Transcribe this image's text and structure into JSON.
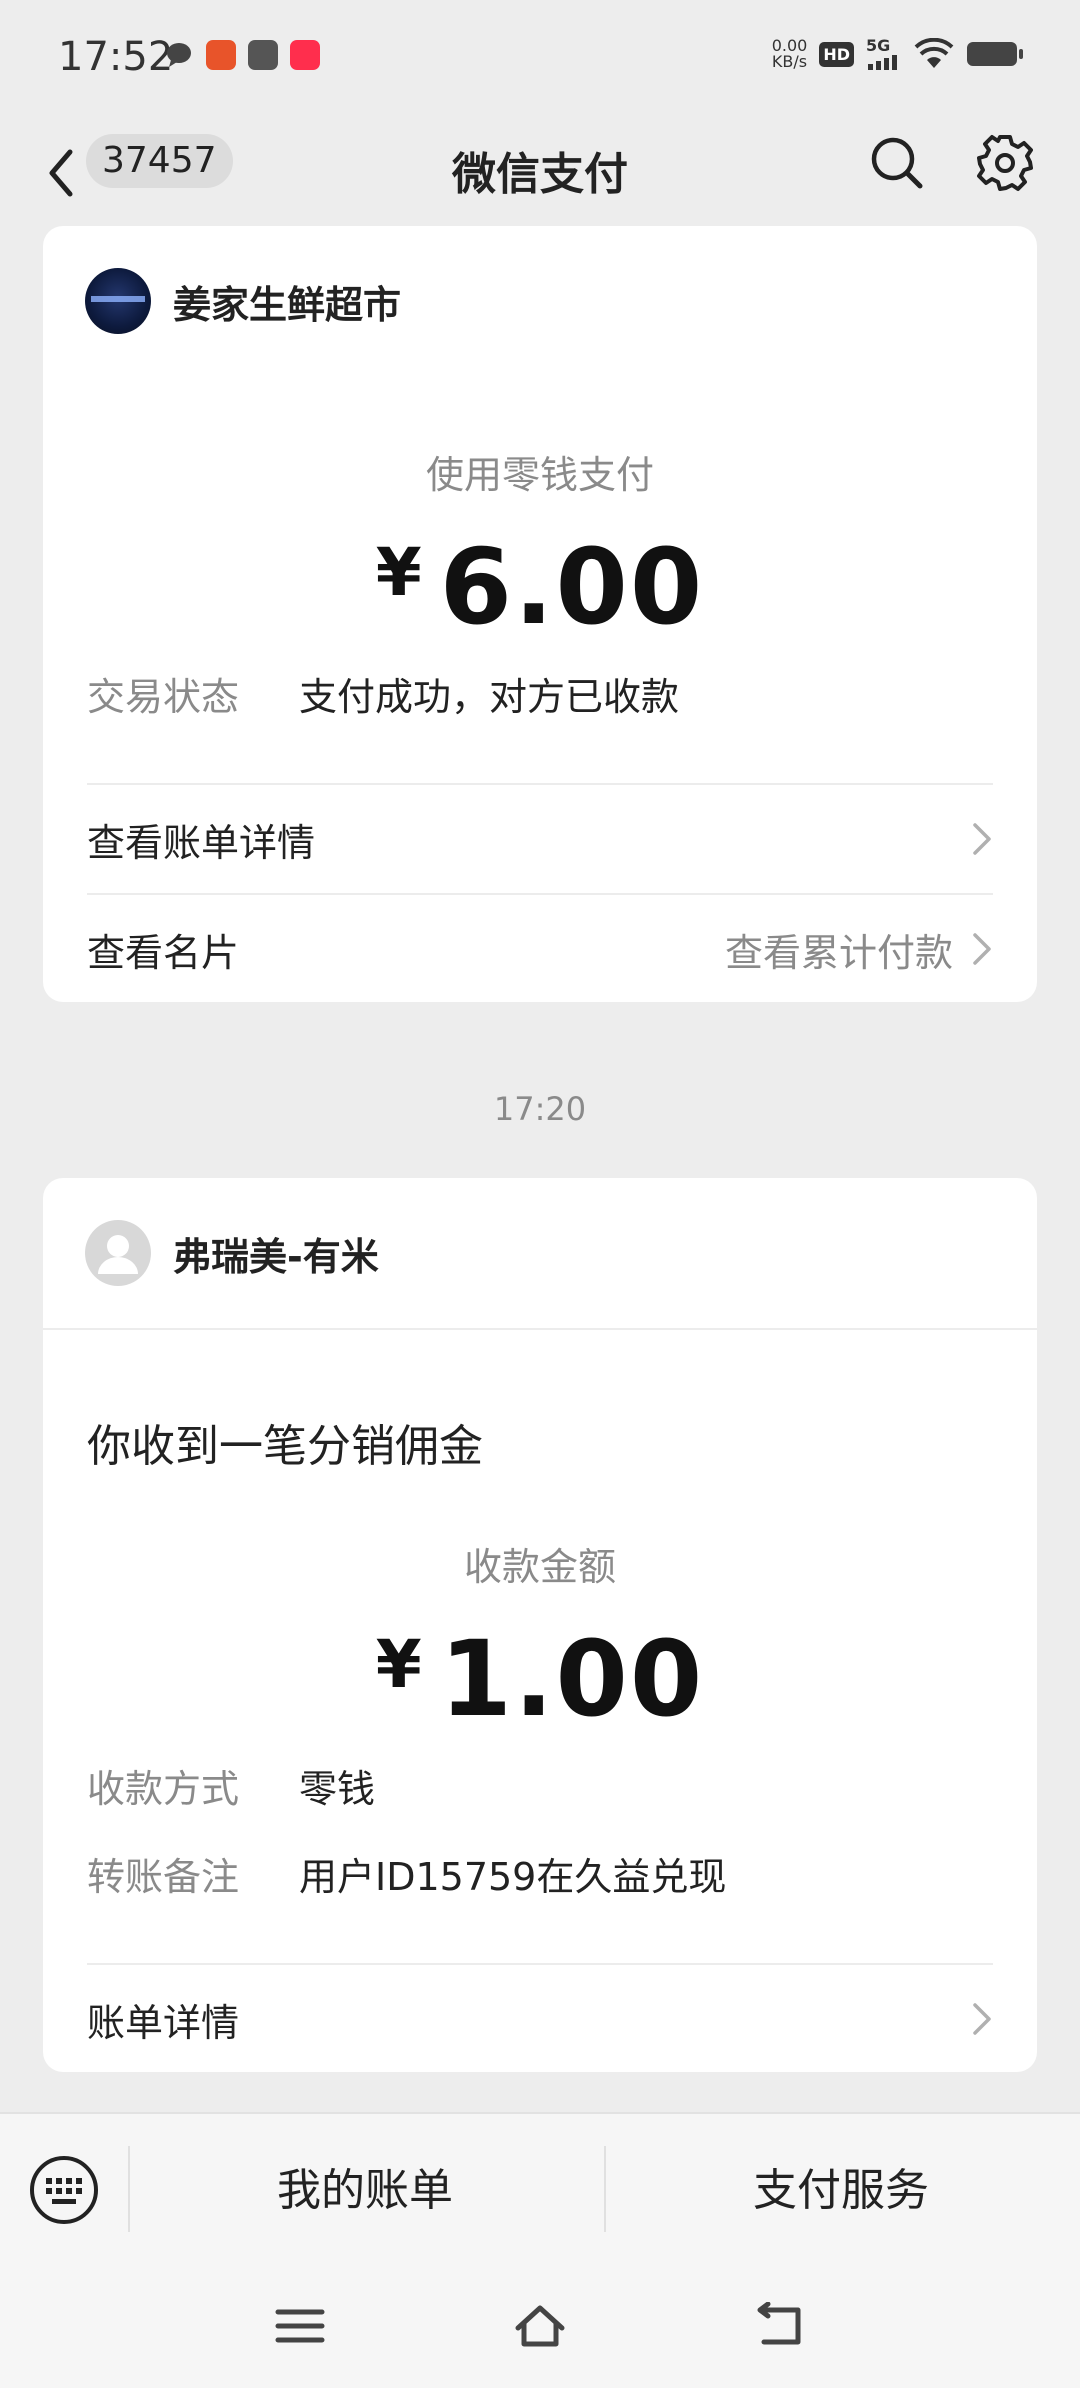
{
  "status": {
    "time": "17:52",
    "net_speed_value": "0.00",
    "net_speed_unit": "KB/s",
    "hd": "HD",
    "network": "5G"
  },
  "nav": {
    "unread_count": "37457",
    "title": "微信支付"
  },
  "payment": {
    "merchant_name": "姜家生鲜超市",
    "method": "使用零钱支付",
    "currency": "¥",
    "amount": "6.00",
    "status_label": "交易状态",
    "status_value": "支付成功，对方已收款",
    "bill_details": "查看账单详情",
    "view_card": "查看名片",
    "view_cumulative": "查看累计付款"
  },
  "timestamp": "17:20",
  "commission": {
    "sender_name": "弗瑞美-有米",
    "notice": "你收到一笔分销佣金",
    "amount_label": "收款金额",
    "currency": "¥",
    "amount": "1.00",
    "method_label": "收款方式",
    "method_value": "零钱",
    "remark_label": "转账备注",
    "remark_value": "用户ID15759在久益兑现",
    "bill_details": "账单详情"
  },
  "bottom": {
    "my_bills": "我的账单",
    "pay_services": "支付服务"
  },
  "icons": {
    "back": "chevron-left-icon",
    "search": "search-icon",
    "settings": "gear-icon",
    "keyboard": "keyboard-icon",
    "menu": "menu-icon",
    "home": "home-icon",
    "back_sys": "back-arrow-icon"
  }
}
